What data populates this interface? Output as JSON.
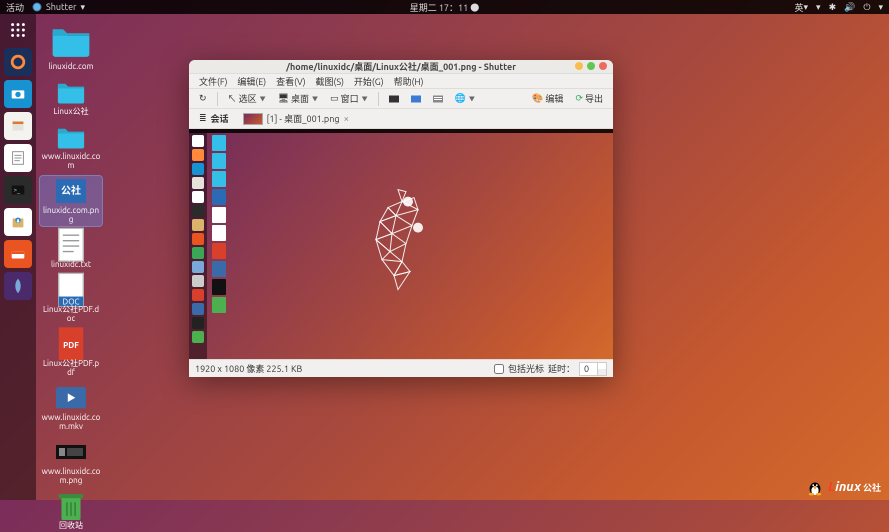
{
  "topbar": {
    "activities": "活动",
    "app": "Shutter",
    "datetime": "星期二 17：11",
    "input": "英"
  },
  "dock": {
    "items": [
      "apps-grid",
      "firefox",
      "camera",
      "files",
      "editor",
      "terminal",
      "software",
      "ubuntu-store",
      "shutter-app"
    ]
  },
  "desktop": {
    "items": [
      {
        "label": "linuxidc.com",
        "icon": "folder"
      },
      {
        "label": "Linux公社",
        "icon": "folder"
      },
      {
        "label": "www.linuxidc.com",
        "icon": "folder"
      },
      {
        "label": "linuxidc.com.png",
        "icon": "image",
        "selected": true
      },
      {
        "label": "linuxidc.txt",
        "icon": "text"
      },
      {
        "label": "Linux公社PDF.doc",
        "icon": "doc"
      },
      {
        "label": "Linux公社PDF.pdf",
        "icon": "pdf"
      },
      {
        "label": "www.linuxidc.com.mkv",
        "icon": "video"
      },
      {
        "label": "www.linuxidc.com.png",
        "icon": "image-dark"
      },
      {
        "label": "回收站",
        "icon": "trash"
      }
    ]
  },
  "window": {
    "title": "/home/linuxidc/桌面/Linux公社/桌面_001.png - Shutter",
    "controls": {
      "min": "#f6be4f",
      "max": "#62c554",
      "close": "#ed6a5e"
    },
    "menubar": [
      "文件(F)",
      "编辑(E)",
      "查看(V)",
      "截图(S)",
      "开始(G)",
      "帮助(H)"
    ],
    "toolbar": {
      "redo": "↻",
      "select_tool": "选区",
      "desktop_tool": "桌面",
      "window_tool": "窗口",
      "edit": "编辑",
      "export": "导出"
    },
    "tabs": {
      "session": "会话",
      "file_tab": "[1] - 桌面_001.png"
    },
    "status": {
      "info": "1920 x 1080 像素  225.1 KB",
      "cursor_label": "包括光标",
      "delay_label": "延时：",
      "delay_value": "0"
    }
  },
  "watermark": {
    "text_main": "Linux",
    "text_sub": "公社"
  }
}
